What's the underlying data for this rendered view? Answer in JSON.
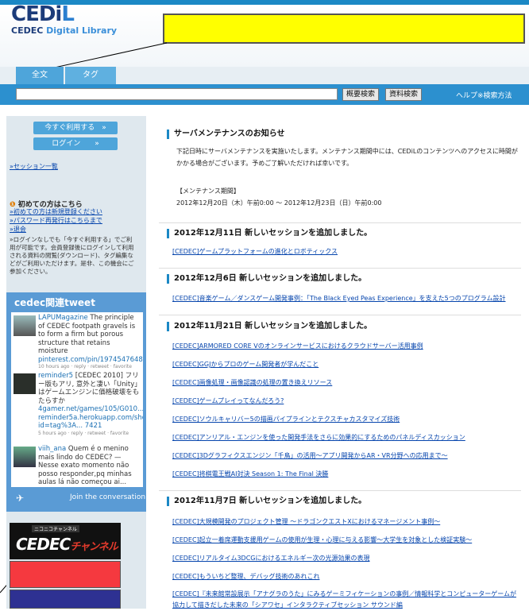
{
  "header": {
    "logo_main": "CEDi",
    "logo_main_accent": "L",
    "logo_sub_prefix": "CEDEC",
    "logo_sub_suffix": "Digital Library",
    "banner_color": "#ffff00"
  },
  "tabs": [
    {
      "label": "全文",
      "active": true
    },
    {
      "label": "タグ",
      "active": false
    }
  ],
  "search": {
    "value": "",
    "summary_button": "概要検索",
    "material_button": "資料検索",
    "help_link": "ヘルプ※検索方法"
  },
  "sidebar": {
    "use_now_button": "今すぐ利用する　»",
    "login_button": "ログイン　　»",
    "session_list_link": "»セッション一覧",
    "first_time_heading": "初めての方はこちら",
    "first_time_links": [
      "»初めての方は新規登録ください",
      "»パスワード再発行はこちらまで",
      "»退会"
    ],
    "note": "»ログインなしでも「今すぐ利用する」でご利用が可能です。会員登録後にログインして利用される資料の閲覧(ダウンロード)、タグ編集などがご利用いただけます。是非、この機会にご参加ください。"
  },
  "tweets": {
    "title": "cedec関連tweet",
    "items": [
      {
        "user": "LAPUMagazine",
        "text": " The principle of CEDEC footpath gravels is to form a firm but porous structure that retains moisture ",
        "link": "pinterest.com/pin/1974547648...",
        "meta": "10 hours ago · reply · retweet · favorite"
      },
      {
        "user": "reminder5",
        "text": " [CEDEC 2010] フリー版もアリ, 意外と凄い「Unity」はゲームエンジンに価格破壊をもたらすか ",
        "link": "4gamer.net/games/105/G010... reminder5a.herokuapp.com/show id=tag%3A... 7421",
        "meta": "5 hours ago · reply · retweet · favorite"
      },
      {
        "user": "viih_ana",
        "text": " Quem é o menino mais lindo do CEDEC? — Nesse exato momento não posso responder,pq minhas aulas lá não começou ai...",
        "link": "",
        "meta": ""
      }
    ],
    "join_label": "Join the conversation"
  },
  "channel": {
    "sub": "ニコニコチャンネル",
    "name": "CEDEC",
    "suffix": "チャンネル"
  },
  "red_box_color": "#f5393f",
  "navy_box_color": "#2e3192",
  "maintenance": {
    "title": "サーバメンテナンスのお知らせ",
    "body": "下記日時にサーバメンテナンスを実施いたします。メンテナンス期間中には、CEDiLのコンテンツへのアクセスに時間がかかる場合がございます。予めご了解いただければ幸いです。",
    "period_label": "【メンテナンス期間】",
    "period": "2012年12月20日（木）午前0:00 ～ 2012年12月23日（日）午前0:00"
  },
  "news": [
    {
      "title": "2012年12月11日 新しいセッションを追加しました。",
      "links": [
        "[CEDEC]ゲームプラットフォームの進化とロボティックス"
      ]
    },
    {
      "title": "2012年12月6日 新しいセッションを追加しました。",
      "links": [
        "[CEDEC]音楽ゲーム／ダンスゲーム開発事例：「The Black Eyed Peas Experience」を支えた5つのプログラム設計"
      ]
    },
    {
      "title": "2012年11月21日 新しいセッションを追加しました。",
      "links": [
        "[CEDEC]ARMORED CORE Vのオンラインサービスにおけるクラウドサーバー活用事例",
        "[CEDEC]GGJからプロのゲーム開発者が学んだこと",
        "[CEDEC]画像処理・画像認識の処理の置き換えリソース",
        "[CEDEC]ゲームプレイってなんだろう?",
        "[CEDEC]ソウルキャリバー5の描画パイプラインとテクスチャカスタマイズ技術",
        "[CEDEC]アンリアル・エンジンを使った開発手法をさらに効果的にするためのパネルディスカッション",
        "[CEDEC]3Dグラフィクスエンジン「千鳥」の活用～アプリ開発からAR・VR分野への応用まで～",
        "[CEDEC]将棋電王戦AI対決 Season 1: The Final 決勝"
      ]
    },
    {
      "title": "2012年11月7日 新しいセッションを追加しました。",
      "links": [
        "[CEDEC]大規模開発のプロジェクト管理 ～ドラゴンクエストXにおけるマネージメント事例～",
        "[CEDEC]起立一着席運動支援用ゲームの使用が生理・心理に与える影響～大学生を対象とした検証実験～",
        "[CEDEC]リアルタイム3DCGにおけるエネルギー次の光源効果の表現",
        "[CEDEC]もういちど整理、デバッグ技術のあれこれ",
        "[CEDEC]『未来館常設展示「アナグラのうた」にみるゲーミフィケーションの事例／情報科学とコンピューターゲームが協力して描きだした未来の「シアワセ」インタラクティブセッション サウンド編"
      ]
    }
  ]
}
